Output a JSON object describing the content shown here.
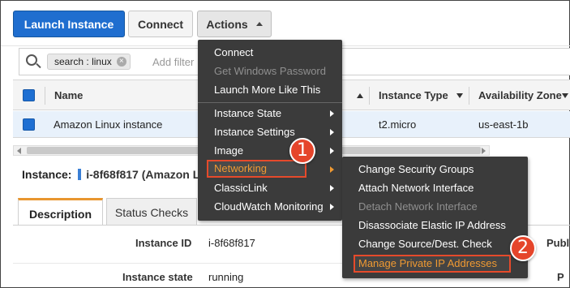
{
  "toolbar": {
    "launch_label": "Launch Instance",
    "connect_label": "Connect",
    "actions_label": "Actions"
  },
  "search": {
    "token_key": "search",
    "token_sep": ":",
    "token_value": "linux",
    "placeholder": "Add filter"
  },
  "table": {
    "columns": {
      "name": "Name",
      "instance_type": "Instance Type",
      "availability_zone": "Availability Zone"
    },
    "row": {
      "name": "Amazon Linux instance",
      "instance_type": "t2.micro",
      "availability_zone": "us-east-1b"
    }
  },
  "details": {
    "instance_label": "Instance:",
    "instance_value": "i-8f68f817 (Amazon L",
    "tabs": [
      "Description",
      "Status Checks"
    ],
    "fields": [
      {
        "label": "Instance ID",
        "value": "i-8f68f817"
      },
      {
        "label": "Instance state",
        "value": "running"
      }
    ],
    "right_label_1": "Publ",
    "right_label_2": "P"
  },
  "actions_menu": {
    "items": [
      {
        "label": "Connect",
        "disabled": false
      },
      {
        "label": "Get Windows Password",
        "disabled": true
      },
      {
        "label": "Launch More Like This",
        "disabled": false
      },
      {
        "label": "Instance State",
        "submenu": true
      },
      {
        "label": "Instance Settings",
        "submenu": true
      },
      {
        "label": "Image",
        "submenu": true
      },
      {
        "label": "Networking",
        "submenu": true,
        "highlighted": true
      },
      {
        "label": "ClassicLink",
        "submenu": true
      },
      {
        "label": "CloudWatch Monitoring",
        "submenu": true
      }
    ]
  },
  "networking_submenu": {
    "items": [
      {
        "label": "Change Security Groups",
        "disabled": false
      },
      {
        "label": "Attach Network Interface",
        "disabled": false
      },
      {
        "label": "Detach Network Interface",
        "disabled": true
      },
      {
        "label": "Disassociate Elastic IP Address",
        "disabled": false
      },
      {
        "label": "Change Source/Dest. Check",
        "disabled": false
      },
      {
        "label": "Manage Private IP Addresses",
        "highlighted": true
      }
    ]
  },
  "callouts": [
    "1",
    "2"
  ],
  "colors": {
    "primary_button": "#1f6ecf",
    "menu_bg": "#3b3b3b",
    "highlight_text": "#f09a32",
    "callout_red": "#e5452b",
    "tab_accent": "#e8962f",
    "selected_row": "#e8f1fb"
  }
}
